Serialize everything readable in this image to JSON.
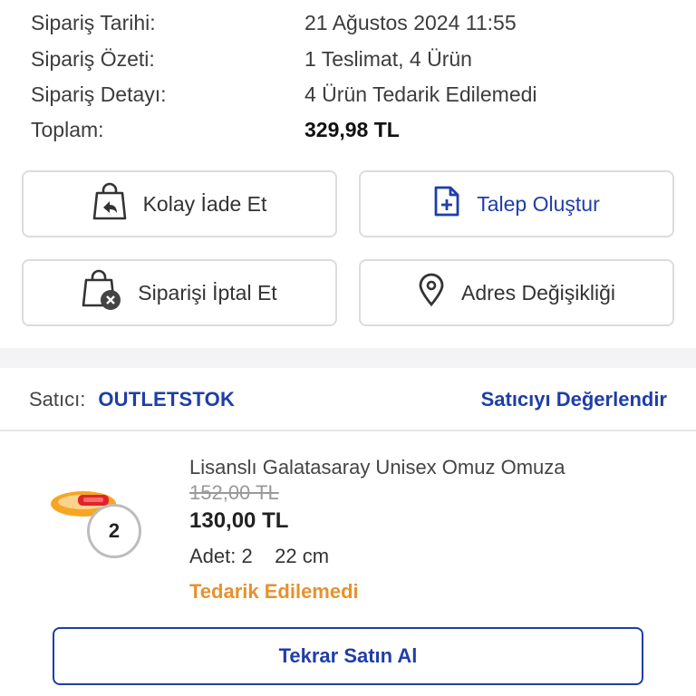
{
  "order": {
    "rows": [
      {
        "label": "Sipariş Tarihi:",
        "value": "21 Ağustos 2024 11:55"
      },
      {
        "label": "Sipariş Özeti:",
        "value": "1 Teslimat, 4 Ürün"
      },
      {
        "label": "Sipariş Detayı:",
        "value": "4 Ürün Tedarik Edilemedi"
      },
      {
        "label": "Toplam:",
        "value": "329,98 TL"
      }
    ]
  },
  "actions": {
    "easy_return": "Kolay İade Et",
    "create_request": "Talep Oluştur",
    "cancel_order": "Siparişi İptal Et",
    "address_change": "Adres Değişikliği"
  },
  "seller": {
    "label": "Satıcı:",
    "name": "OUTLETSTOK",
    "rate_link": "Satıcıyı Değerlendir"
  },
  "product": {
    "title": "Lisanslı Galatasaray Unisex Omuz Omuza",
    "old_price": "152,00 TL",
    "price": "130,00 TL",
    "quantity_line": "Adet: 2    22 cm",
    "badge_count": "2",
    "status": "Tedarik Edilemedi"
  },
  "rebuy_button": "Tekrar Satın Al",
  "colors": {
    "accent": "#1f3ea8",
    "status_orange": "#e8912d"
  }
}
